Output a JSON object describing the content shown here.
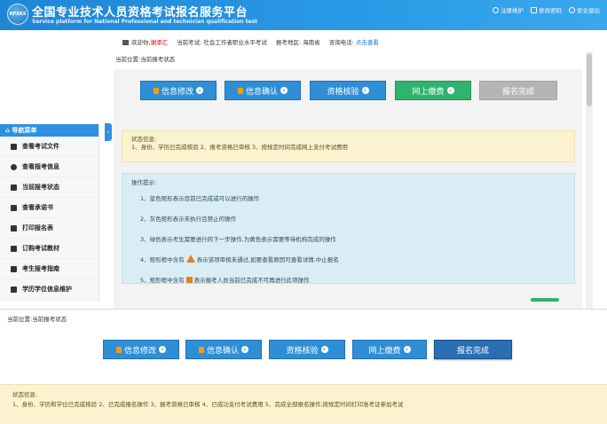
{
  "header": {
    "logo_text": "KPXKS",
    "title_cn": "全国专业技术人员资格考试报名服务平台",
    "title_en": "Service platform for National Professional and technician qualification test",
    "links": [
      "注册维护",
      "修改密码",
      "安全退出"
    ]
  },
  "info_bar": {
    "welcome_label": "欢迎你,",
    "user_name": "谢添汇",
    "exam_label": "当前考试:",
    "exam_name": "社会工作者职业水平考试",
    "region_label": "报考地区:",
    "region": "海南省",
    "phone_label": "咨询电话:",
    "phone_link": "点击查看"
  },
  "location1": "当前位置:当前报考状态",
  "top_buttons": [
    {
      "label": "信息修改",
      "style": "blue"
    },
    {
      "label": "信息确认",
      "style": "blue"
    },
    {
      "label": "资格核验",
      "style": "blue"
    },
    {
      "label": "网上缴费",
      "style": "green"
    },
    {
      "label": "报名完成",
      "style": "gray"
    }
  ],
  "sidebar": {
    "header": "导航菜单",
    "items": [
      "查看考试文件",
      "查看报考信息",
      "当前报考状态",
      "查看承诺书",
      "打印报名表",
      "订购考试教材",
      "考生报考指南",
      "学历学位信息维护"
    ]
  },
  "status_box": {
    "title": "状态信息:",
    "text": "1、身份、学历已完成核验 2、报考资格已审核 3、按规定时间完成网上支付考试费用"
  },
  "ops_box": {
    "title": "操作提示:",
    "lines": [
      "1、蓝色矩形表示目前已完成或可以进行的操作",
      "2、灰色矩形表示未执行且禁止的操作",
      "3、绿色表示考生需要进行的下一步操作,为黄色表示需要等待机构完成的操作",
      "4、矩形框中含有",
      "5、矩形框中含有"
    ],
    "line4_suffix": "表示该项审核未通过,如要查看原因可查看详情,中止报名",
    "line5_suffix": "表示报考人员当前已完成不可再进行此项操作"
  },
  "location2": "当前位置:当前报考状态",
  "bottom_buttons": [
    {
      "label": "信息修改",
      "style": "blue"
    },
    {
      "label": "信息确认",
      "style": "blue"
    },
    {
      "label": "资格核验",
      "style": "blue"
    },
    {
      "label": "网上缴费",
      "style": "blue"
    },
    {
      "label": "报名完成",
      "style": "dark"
    }
  ],
  "bottom_status": {
    "title": "状态信息:",
    "text": "1、身份、学历和学位已完成核验 2、已完成报名操作 3、报考资格已审核 4、已成功支付考试费用 5、完成全部报名操作,按规定时间打印准考证参加考试"
  },
  "colors": {
    "header_blue": "#2a9ae6",
    "button_blue": "#2f8fd6",
    "button_green": "#2fb36e",
    "button_gray": "#b5b5b5",
    "status_yellow": "#fbf3cf",
    "ops_blue": "#d8eef4"
  }
}
